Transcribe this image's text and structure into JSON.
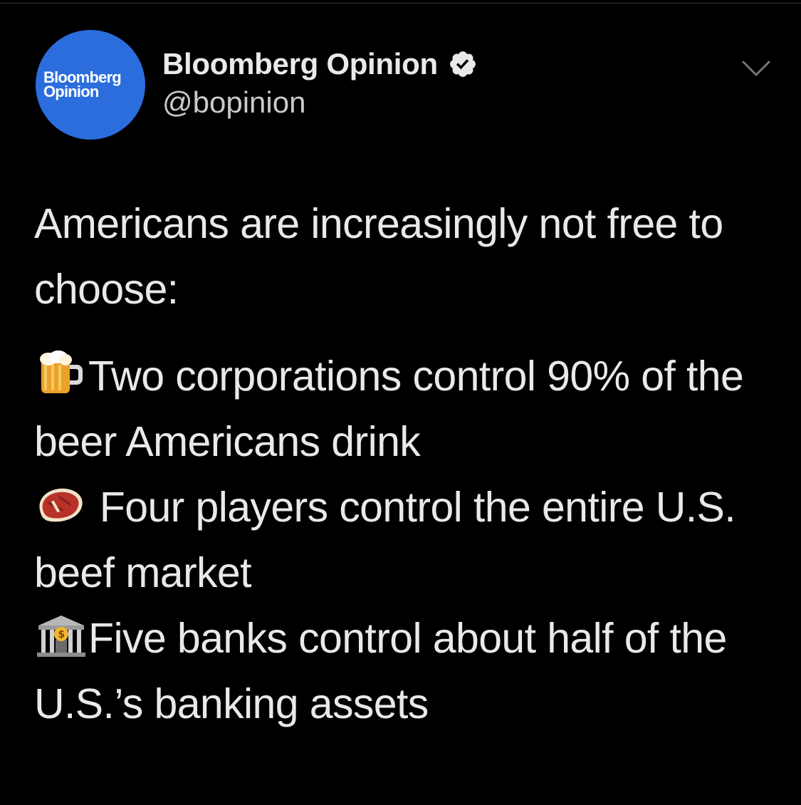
{
  "tweet": {
    "author": {
      "avatar_text_line1": "Bloomberg",
      "avatar_text_line2": "Opinion",
      "display_name": "Bloomberg Opinion",
      "handle": "@bopinion",
      "verified": true
    },
    "intro": "Americans are increasingly not free to choose:",
    "bullets": [
      {
        "icon": "beer-mug-icon",
        "text": "Two corporations control 90% of the beer Americans drink"
      },
      {
        "icon": "steak-icon",
        "text": " Four players control the entire U.S. beef market"
      },
      {
        "icon": "bank-icon",
        "text": "Five banks control about half of the U.S.’s banking assets"
      }
    ]
  },
  "colors": {
    "background": "#000000",
    "text": "#e7e9ea",
    "secondary_text": "#c7cbce",
    "avatar": "#2b6ddd",
    "verified_badge": "#e7e9ea"
  }
}
